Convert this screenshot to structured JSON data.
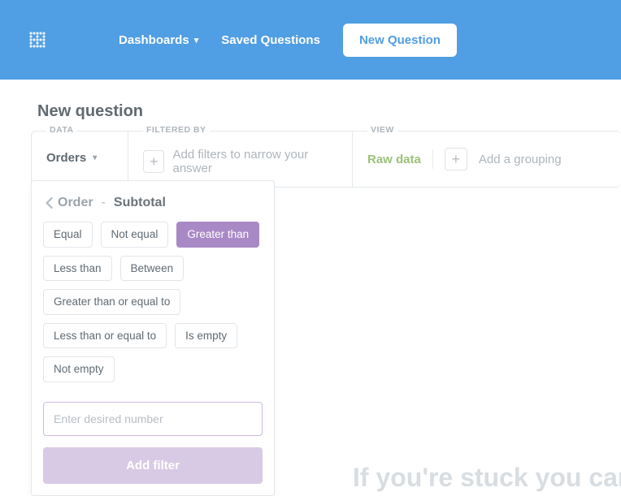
{
  "header": {
    "nav": {
      "dashboards": "Dashboards",
      "saved_questions": "Saved Questions"
    },
    "new_question_button": "New Question"
  },
  "page": {
    "title": "New question"
  },
  "builder": {
    "data": {
      "label": "DATA",
      "value": "Orders"
    },
    "filter": {
      "label": "FILTERED BY",
      "hint": "Add filters to narrow your answer"
    },
    "view": {
      "label": "VIEW",
      "raw_data": "Raw data",
      "group_hint": "Add a grouping"
    }
  },
  "popover": {
    "breadcrumb_parent": "Order",
    "breadcrumb_field": "Subtotal",
    "operators": [
      {
        "label": "Equal",
        "selected": false
      },
      {
        "label": "Not equal",
        "selected": false
      },
      {
        "label": "Greater than",
        "selected": true
      },
      {
        "label": "Less than",
        "selected": false
      },
      {
        "label": "Between",
        "selected": false
      },
      {
        "label": "Greater than or equal to",
        "selected": false
      },
      {
        "label": "Less than or equal to",
        "selected": false
      },
      {
        "label": "Is empty",
        "selected": false
      },
      {
        "label": "Not empty",
        "selected": false
      }
    ],
    "number_placeholder": "Enter desired number",
    "add_filter": "Add filter"
  },
  "footer_ghost": "If you're stuck you can alw"
}
